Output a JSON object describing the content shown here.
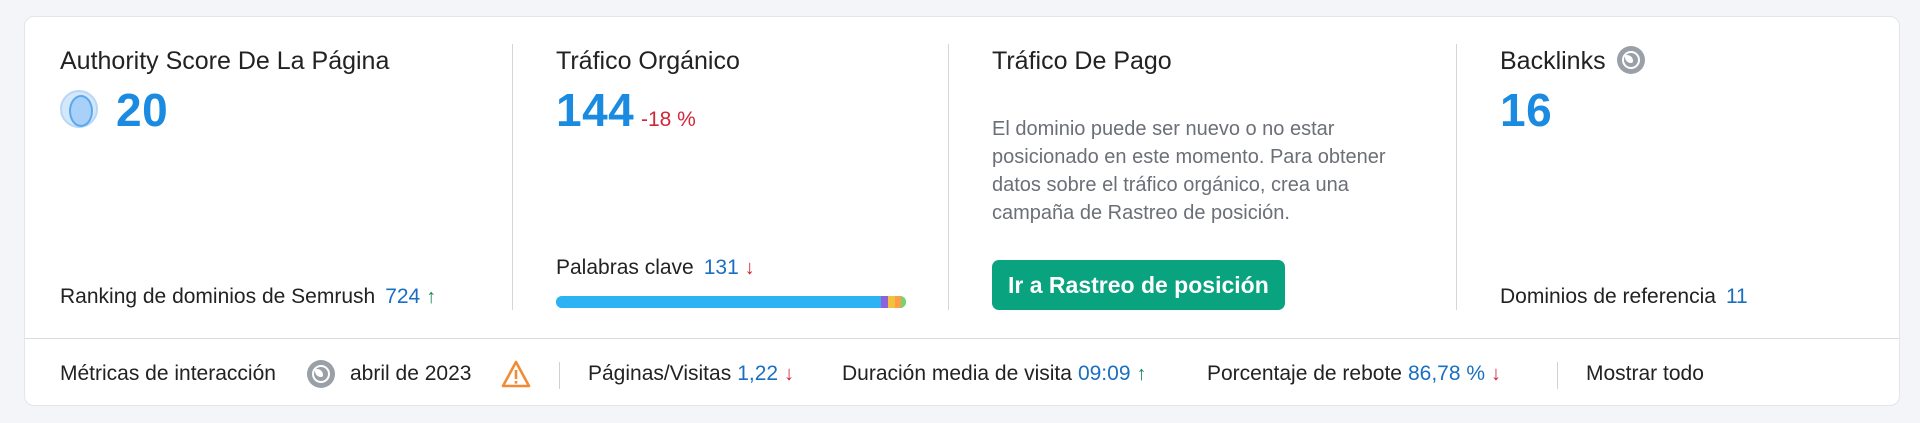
{
  "authority": {
    "title": "Authority Score De La Página",
    "score": "20",
    "ranking_label": "Ranking de dominios de Semrush",
    "ranking_value": "724",
    "ranking_trend": "↑"
  },
  "organic": {
    "title": "Tráfico Orgánico",
    "value": "144",
    "change": "-18 %",
    "keywords_label": "Palabras clave",
    "keywords_value": "131",
    "keywords_trend": "↓",
    "keyword_distribution": [
      {
        "name": "segment-1",
        "share": 0.929,
        "color": "#2db3f4"
      },
      {
        "name": "segment-2",
        "share": 0.02,
        "color": "#8e62d9"
      },
      {
        "name": "segment-3",
        "share": 0.02,
        "color": "#f3c23c"
      },
      {
        "name": "segment-4",
        "share": 0.017,
        "color": "#ff9e4a"
      },
      {
        "name": "segment-5",
        "share": 0.014,
        "color": "#7bd36f"
      }
    ]
  },
  "paid": {
    "title": "Tráfico De Pago",
    "message": "El dominio puede ser nuevo o no estar posicionado en este momento. Para obtener datos sobre el tráfico orgánico, crea una campaña de Rastreo de posición.",
    "button_label": "Ir a Rastreo de posición"
  },
  "backlinks": {
    "title": "Backlinks",
    "icon": "globe-icon",
    "value": "16",
    "ref_domains_label": "Dominios de referencia",
    "ref_domains_value": "11"
  },
  "engagement": {
    "label": "Métricas de interacción",
    "globe_icon": "globe-icon",
    "date": "abril de 2023",
    "warning_icon": "warning-icon",
    "pages_label": "Páginas/Visitas",
    "pages_value": "1,22",
    "pages_trend": "↓",
    "duration_label": "Duración media de visita",
    "duration_value": "09:09",
    "duration_trend": "↑",
    "bounce_label": "Porcentaje de rebote",
    "bounce_value": "86,78 %",
    "bounce_trend": "↓",
    "show_all": "Mostrar todo"
  },
  "colors": {
    "accent_blue": "#1a8be0",
    "link_blue": "#1a6fc2",
    "negative_red": "#d1263b",
    "positive_green": "#1a8a5a",
    "button_green": "#0aa37f",
    "warning_orange": "#f28b35"
  }
}
